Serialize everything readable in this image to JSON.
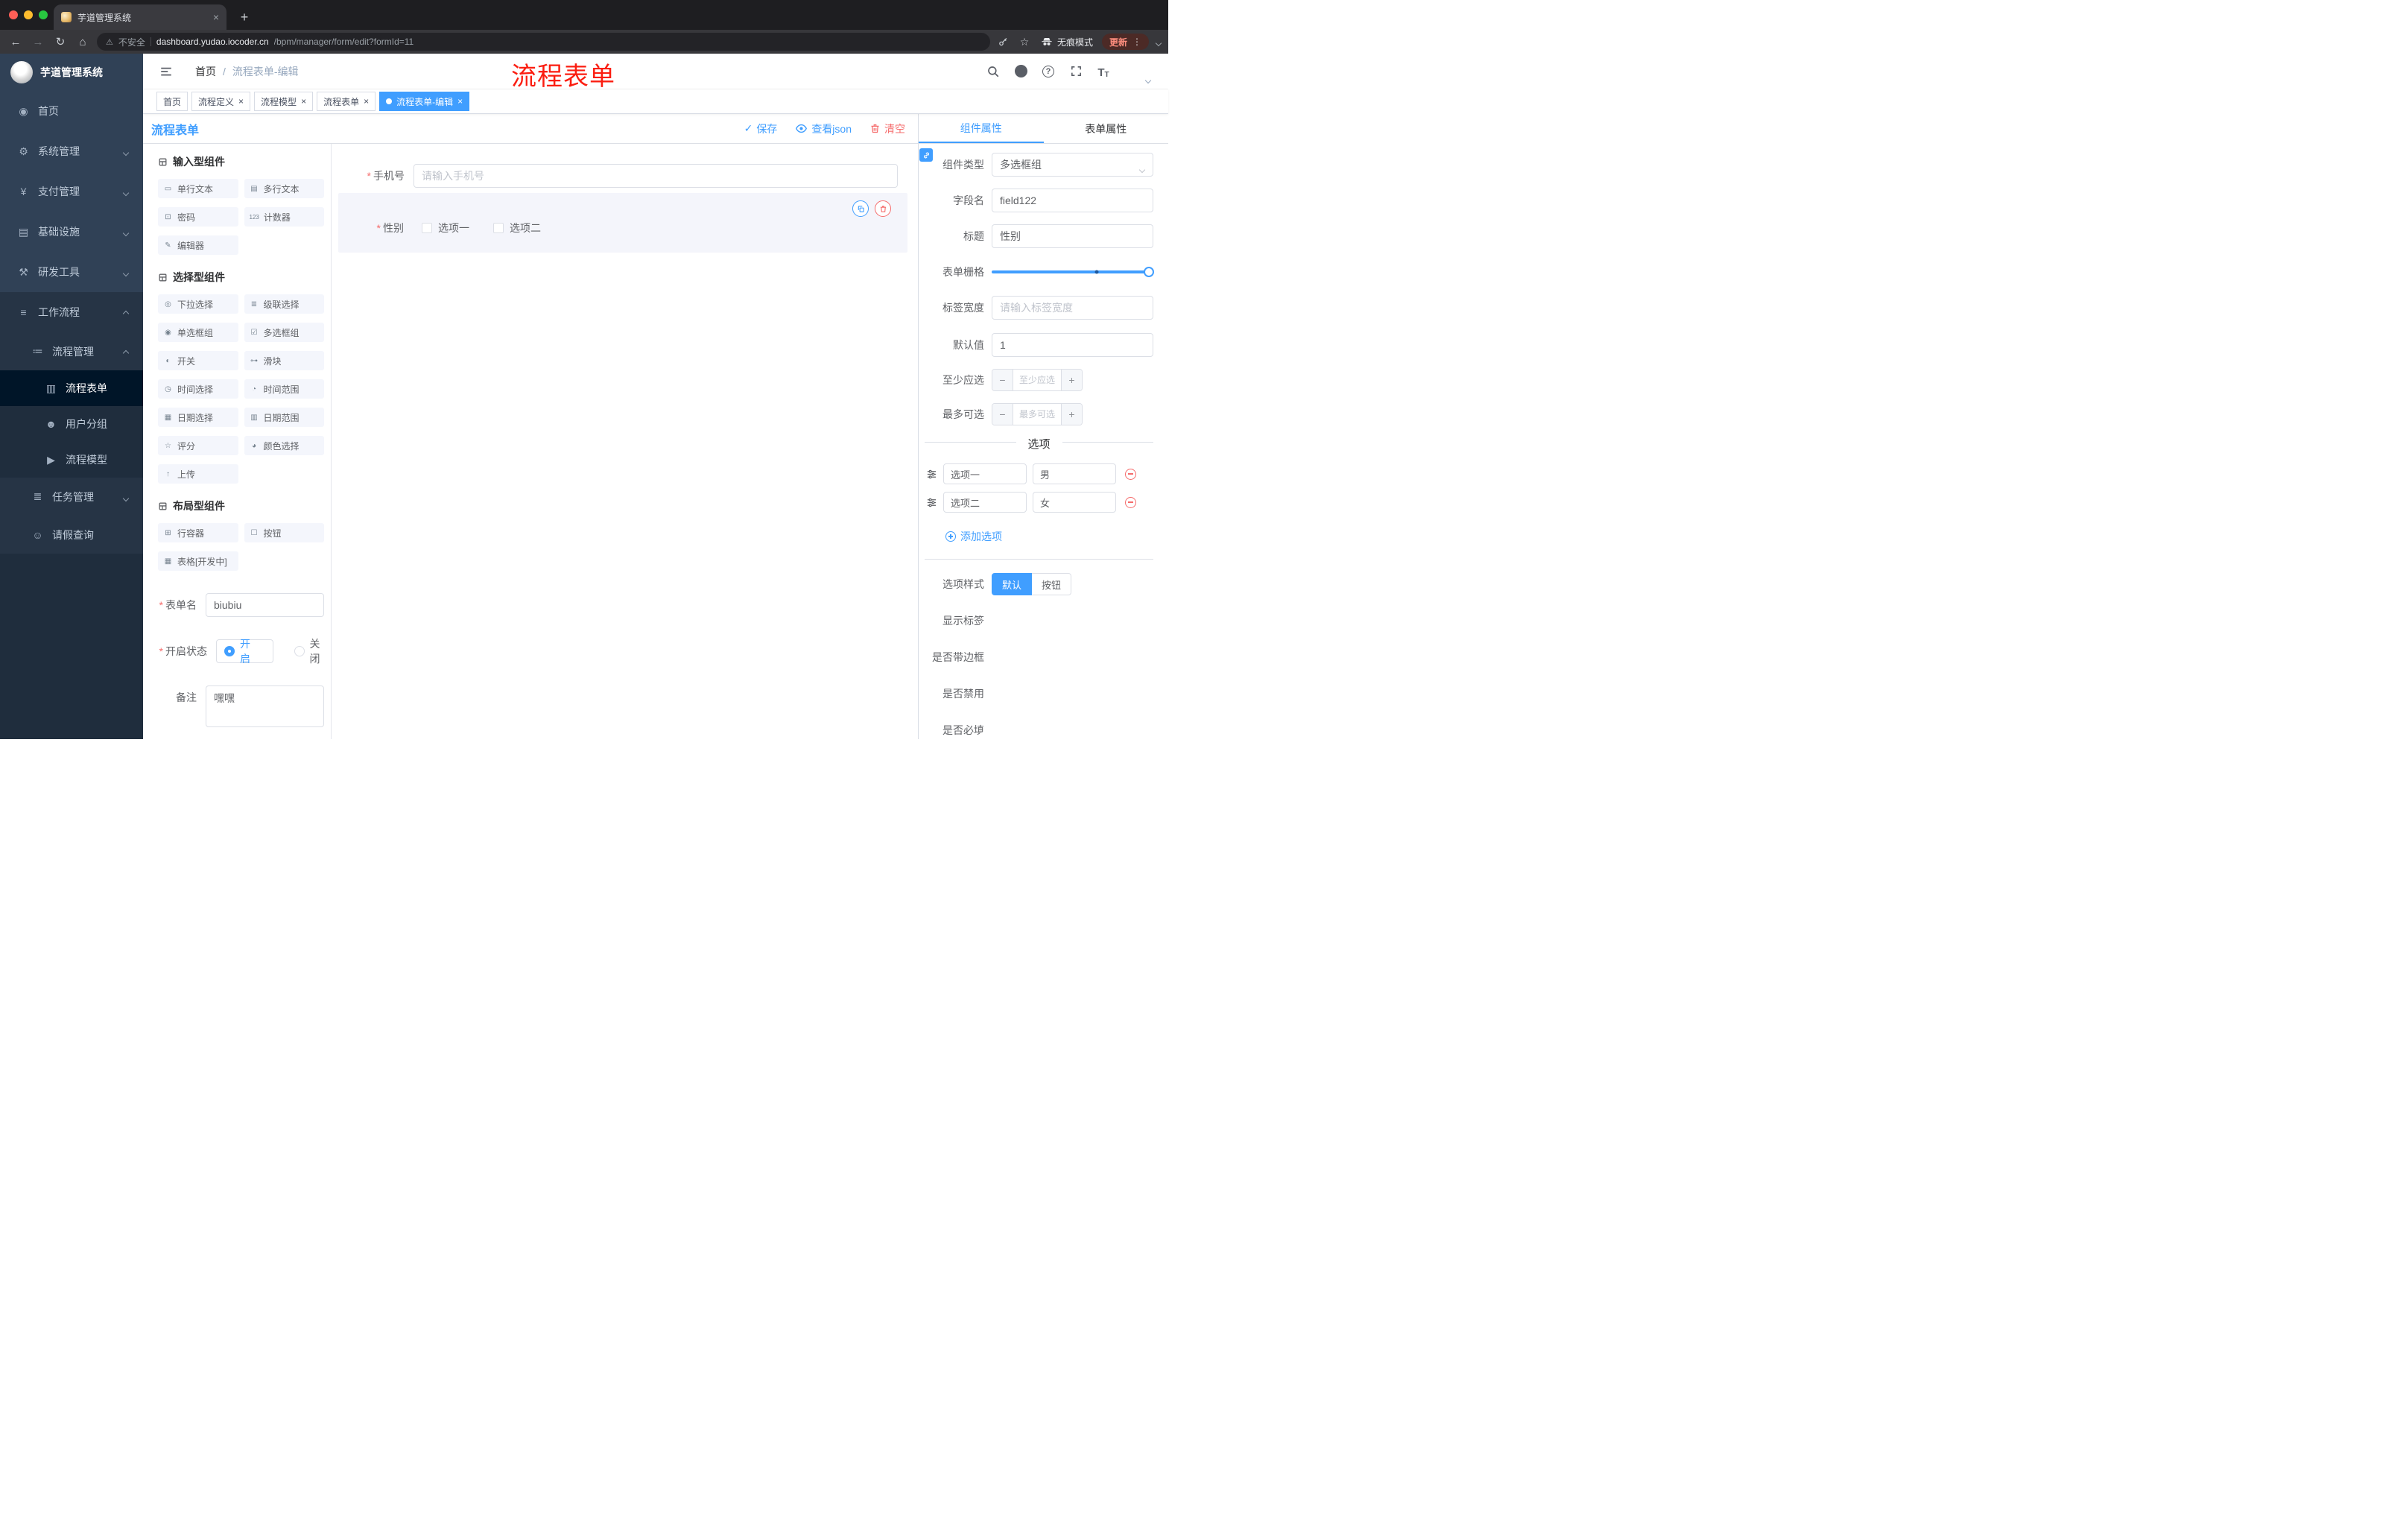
{
  "colors": {
    "primary": "#409eff",
    "danger": "#f56c6c",
    "annotation": "#fb1d10",
    "sidebar_bg": "#304156"
  },
  "glyphs": {
    "close": "×",
    "plus": "+",
    "minus": "−",
    "dots": "⋮",
    "check": "✓",
    "warning": "⚠",
    "star": "☆",
    "back": "←",
    "forward": "→",
    "reload": "↻",
    "home": "⌂",
    "slash": "/",
    "required": "*",
    "question": "?",
    "textsize_large": "T",
    "textsize_small": "T"
  },
  "browser": {
    "tab_title": "芋道管理系统",
    "security_label": "不安全",
    "url_host": "dashboard.yudao.iocoder.cn",
    "url_path": "/bpm/manager/form/edit?formId=11",
    "incognito_label": "无痕模式",
    "update_label": "更新"
  },
  "sidebar": {
    "logo_title": "芋道管理系统",
    "top_items": [
      {
        "label": "首页",
        "icon": "dashboard-icon",
        "glyph": "◉"
      },
      {
        "label": "系统管理",
        "icon": "gear-icon",
        "glyph": "⚙"
      },
      {
        "label": "支付管理",
        "icon": "yen-icon",
        "glyph": "¥"
      },
      {
        "label": "基础设施",
        "icon": "server-icon",
        "glyph": "▤"
      },
      {
        "label": "研发工具",
        "icon": "tools-icon",
        "glyph": "⚒"
      },
      {
        "label": "工作流程",
        "icon": "workflow-icon",
        "glyph": "≡"
      }
    ],
    "process_mgmt": {
      "label": "流程管理",
      "glyph": "≔"
    },
    "process_children": [
      {
        "label": "流程表单",
        "glyph": "▥"
      },
      {
        "label": "用户分组",
        "glyph": "☻"
      },
      {
        "label": "流程模型",
        "glyph": "▶"
      }
    ],
    "task_mgmt": {
      "label": "任务管理",
      "glyph": "≣"
    },
    "leave_query": {
      "label": "请假查询",
      "glyph": "☺"
    }
  },
  "header": {
    "breadcrumb_home": "首页",
    "breadcrumb_current": "流程表单-编辑",
    "annotation": "流程表单"
  },
  "view_tabs": [
    {
      "label": "首页"
    },
    {
      "label": "流程定义"
    },
    {
      "label": "流程模型"
    },
    {
      "label": "流程表单"
    },
    {
      "label": "流程表单-编辑"
    }
  ],
  "designer": {
    "title": "流程表单",
    "save": "保存",
    "view_json": "查看json",
    "clear": "清空"
  },
  "components": {
    "groups": [
      {
        "title": "输入型组件",
        "items": [
          {
            "label": "单行文本",
            "glyph": "▭"
          },
          {
            "label": "多行文本",
            "glyph": "▤"
          },
          {
            "label": "密码",
            "glyph": "⊡"
          },
          {
            "label": "计数器",
            "glyph": "123"
          },
          {
            "label": "编辑器",
            "glyph": "✎"
          }
        ]
      },
      {
        "title": "选择型组件",
        "items": [
          {
            "label": "下拉选择",
            "glyph": "◎"
          },
          {
            "label": "级联选择",
            "glyph": "≣"
          },
          {
            "label": "单选框组",
            "glyph": "◉"
          },
          {
            "label": "多选框组",
            "glyph": "☑"
          },
          {
            "label": "开关",
            "glyph": "◐"
          },
          {
            "label": "滑块",
            "glyph": "⊶"
          },
          {
            "label": "时间选择",
            "glyph": "◷"
          },
          {
            "label": "时间范围",
            "glyph": "◔"
          },
          {
            "label": "日期选择",
            "glyph": "▦"
          },
          {
            "label": "日期范围",
            "glyph": "▥"
          },
          {
            "label": "评分",
            "glyph": "☆"
          },
          {
            "label": "颜色选择",
            "glyph": "◕"
          },
          {
            "label": "上传",
            "glyph": "↑"
          }
        ]
      },
      {
        "title": "布局型组件",
        "items": [
          {
            "label": "行容器",
            "glyph": "⊞"
          },
          {
            "label": "按钮",
            "glyph": "☐"
          },
          {
            "label": "表格[开发中]",
            "glyph": "▦"
          }
        ]
      }
    ]
  },
  "meta_form": {
    "name_label": "表单名",
    "name_value": "biubiu",
    "status_label": "开启状态",
    "status_on": "开启",
    "status_off": "关闭",
    "remark_label": "备注",
    "remark_value": "嘿嘿"
  },
  "canvas": {
    "phone_label": "手机号",
    "phone_placeholder": "请输入手机号",
    "gender_label": "性别",
    "gender_option1": "选项一",
    "gender_option2": "选项二"
  },
  "props": {
    "tab_component": "组件属性",
    "tab_form": "表单属性",
    "type_label": "组件类型",
    "type_value": "多选框组",
    "field_label": "字段名",
    "field_value": "field122",
    "title_label": "标题",
    "title_value": "性别",
    "grid_label": "表单栅格",
    "tagw_label": "标签宽度",
    "tagw_placeholder": "请输入标签宽度",
    "default_label": "默认值",
    "default_value": "1",
    "min_label": "至少应选",
    "min_placeholder": "至少应选",
    "max_label": "最多可选",
    "max_placeholder": "最多可选",
    "options_divider": "选项",
    "options": [
      {
        "name": "选项一",
        "value": "男"
      },
      {
        "name": "选项二",
        "value": "女"
      }
    ],
    "add_option": "添加选项",
    "style_label": "选项样式",
    "style_default": "默认",
    "style_button": "按钮",
    "toggle_show_label": "显示标签",
    "toggle_border": "是否带边框",
    "toggle_disabled": "是否禁用",
    "toggle_required": "是否必填"
  }
}
